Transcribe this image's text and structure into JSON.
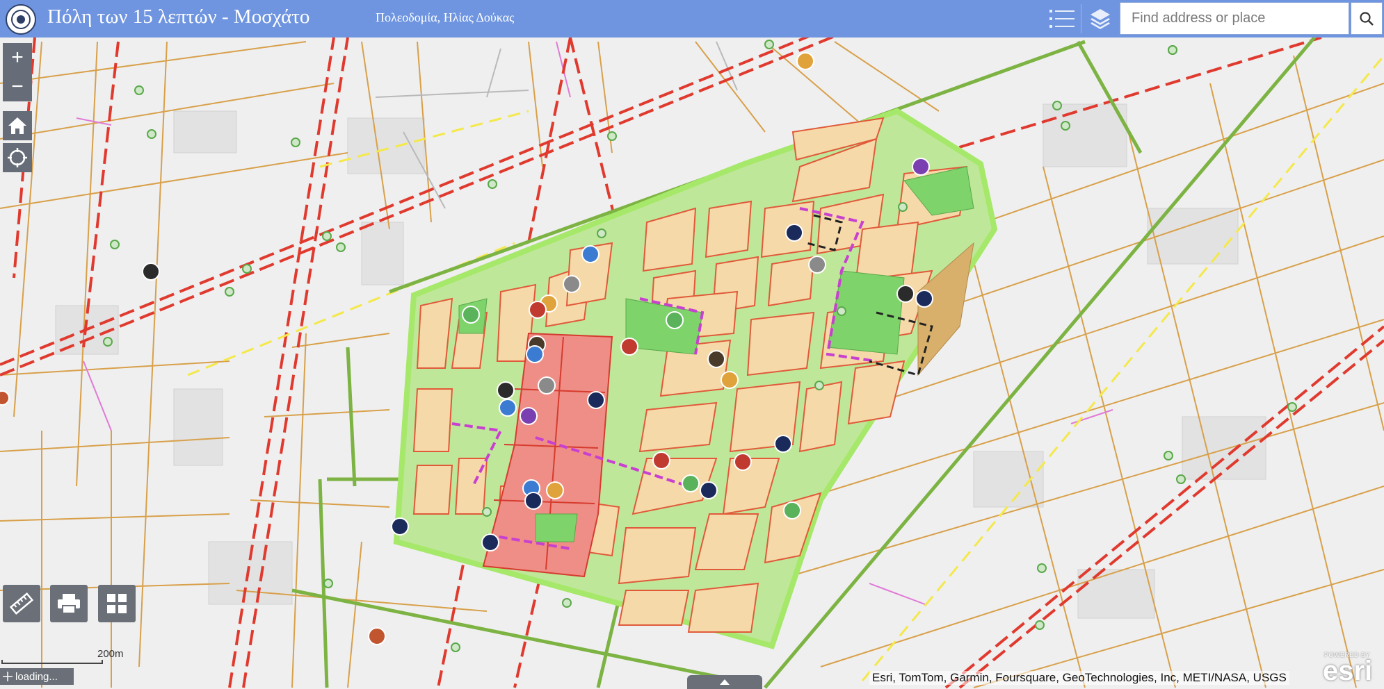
{
  "header": {
    "title": "Πόλη των 15 λεπτών - Μοσχάτο",
    "subtitle": "Πολεοδομία, Ηλίας Δούκας",
    "search_placeholder": "Find address or place",
    "list_icon": "list-icon",
    "layers_icon": "layers-icon",
    "search_icon": "search-icon"
  },
  "map_controls": {
    "zoom_in": "+",
    "zoom_out": "−",
    "home_icon": "home-icon",
    "locate_icon": "locate-icon"
  },
  "tools": {
    "measure_icon": "ruler-icon",
    "print_icon": "printer-icon",
    "basemap_icon": "grid-icon"
  },
  "scale_label": "200m",
  "status": "loading...",
  "attribution": "Esri, TomTom, Garmin, Foursquare, GeoTechnologies, Inc, METI/NASA, USGS",
  "esri_logo": {
    "powered": "POWERED BY",
    "name": "esri"
  },
  "colors": {
    "header": "#6f95e0",
    "primary_road": "#e03a2f",
    "road": "#d8a04a",
    "green_route": "#7cb342",
    "block_fill": "#f6d9a8",
    "center_fill": "#ef8e86",
    "park": "#7ed36b",
    "boundary": "#a6e86a"
  }
}
